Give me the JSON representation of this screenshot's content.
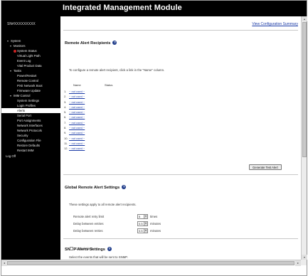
{
  "header": {
    "title": "Integrated Management Module"
  },
  "sidebar": {
    "host": "SN#XXXXXXXXX",
    "items": [
      {
        "label": "System",
        "level": 0,
        "arrow": "▾"
      },
      {
        "label": "Monitors",
        "level": 1,
        "arrow": "▾"
      },
      {
        "label": "System Status",
        "level": 2,
        "dot": true
      },
      {
        "label": "Virtual Light Path",
        "level": 2
      },
      {
        "label": "Event Log",
        "level": 2
      },
      {
        "label": "Vital Product Data",
        "level": 2
      },
      {
        "label": "Tasks",
        "level": 1,
        "arrow": "▾"
      },
      {
        "label": "Power/Restart",
        "level": 2
      },
      {
        "label": "Remote Control",
        "level": 2
      },
      {
        "label": "PXE Network Boot",
        "level": 2
      },
      {
        "label": "Firmware Update",
        "level": 2
      },
      {
        "label": "IMM Control",
        "level": 1,
        "arrow": "▾"
      },
      {
        "label": "System Settings",
        "level": 2
      },
      {
        "label": "Login Profiles",
        "level": 2
      },
      {
        "label": "Alerts",
        "level": 2,
        "selected": true
      },
      {
        "label": "Serial Port",
        "level": 2
      },
      {
        "label": "Port Assignments",
        "level": 2
      },
      {
        "label": "Network Interfaces",
        "level": 2
      },
      {
        "label": "Network Protocols",
        "level": 2
      },
      {
        "label": "Security",
        "level": 2
      },
      {
        "label": "Configuration File",
        "level": 2
      },
      {
        "label": "Restore Defaults",
        "level": 2
      },
      {
        "label": "Restart IMM",
        "level": 2
      }
    ],
    "logoff": "Log Off"
  },
  "main": {
    "summary_link": "View Configuration Summary",
    "remote_alert": {
      "title": "Remote Alert Recipients",
      "desc": "To configure a remote alert recipient, click a link in the \"Name\" column.",
      "col_name": "Name",
      "col_status": "Status",
      "recipients": [
        {
          "num": "1.",
          "name": "~ not used ~"
        },
        {
          "num": "2.",
          "name": "~ not used ~"
        },
        {
          "num": "3.",
          "name": "~ not used ~"
        },
        {
          "num": "4.",
          "name": "~ not used ~"
        },
        {
          "num": "5.",
          "name": "~ not used ~"
        },
        {
          "num": "6.",
          "name": "~ not used ~"
        },
        {
          "num": "7.",
          "name": "~ not used ~"
        },
        {
          "num": "8.",
          "name": "~ not used ~"
        },
        {
          "num": "9.",
          "name": "~ not used ~"
        },
        {
          "num": "10.",
          "name": "~ not used ~"
        },
        {
          "num": "11.",
          "name": "~ not used ~"
        },
        {
          "num": "12.",
          "name": "~ not used ~"
        }
      ],
      "generate_button": "Generate Test Alert"
    },
    "global_settings": {
      "title": "Global Remote Alert Settings",
      "desc": "These settings apply to all remote alert recipients.",
      "fields": [
        {
          "label": "Remote alert retry limit",
          "value": "5",
          "unit": "times"
        },
        {
          "label": "Delay between entries",
          "value": "0.5",
          "unit": "minutes"
        },
        {
          "label": "Delay between retries",
          "value": "0.5",
          "unit": "minutes"
        }
      ]
    },
    "snmp": {
      "title": "SNMP Alerts Settings",
      "desc": "Select the events that will be sent to SNMP.",
      "checkbox_label": "Critical Alerts"
    }
  }
}
